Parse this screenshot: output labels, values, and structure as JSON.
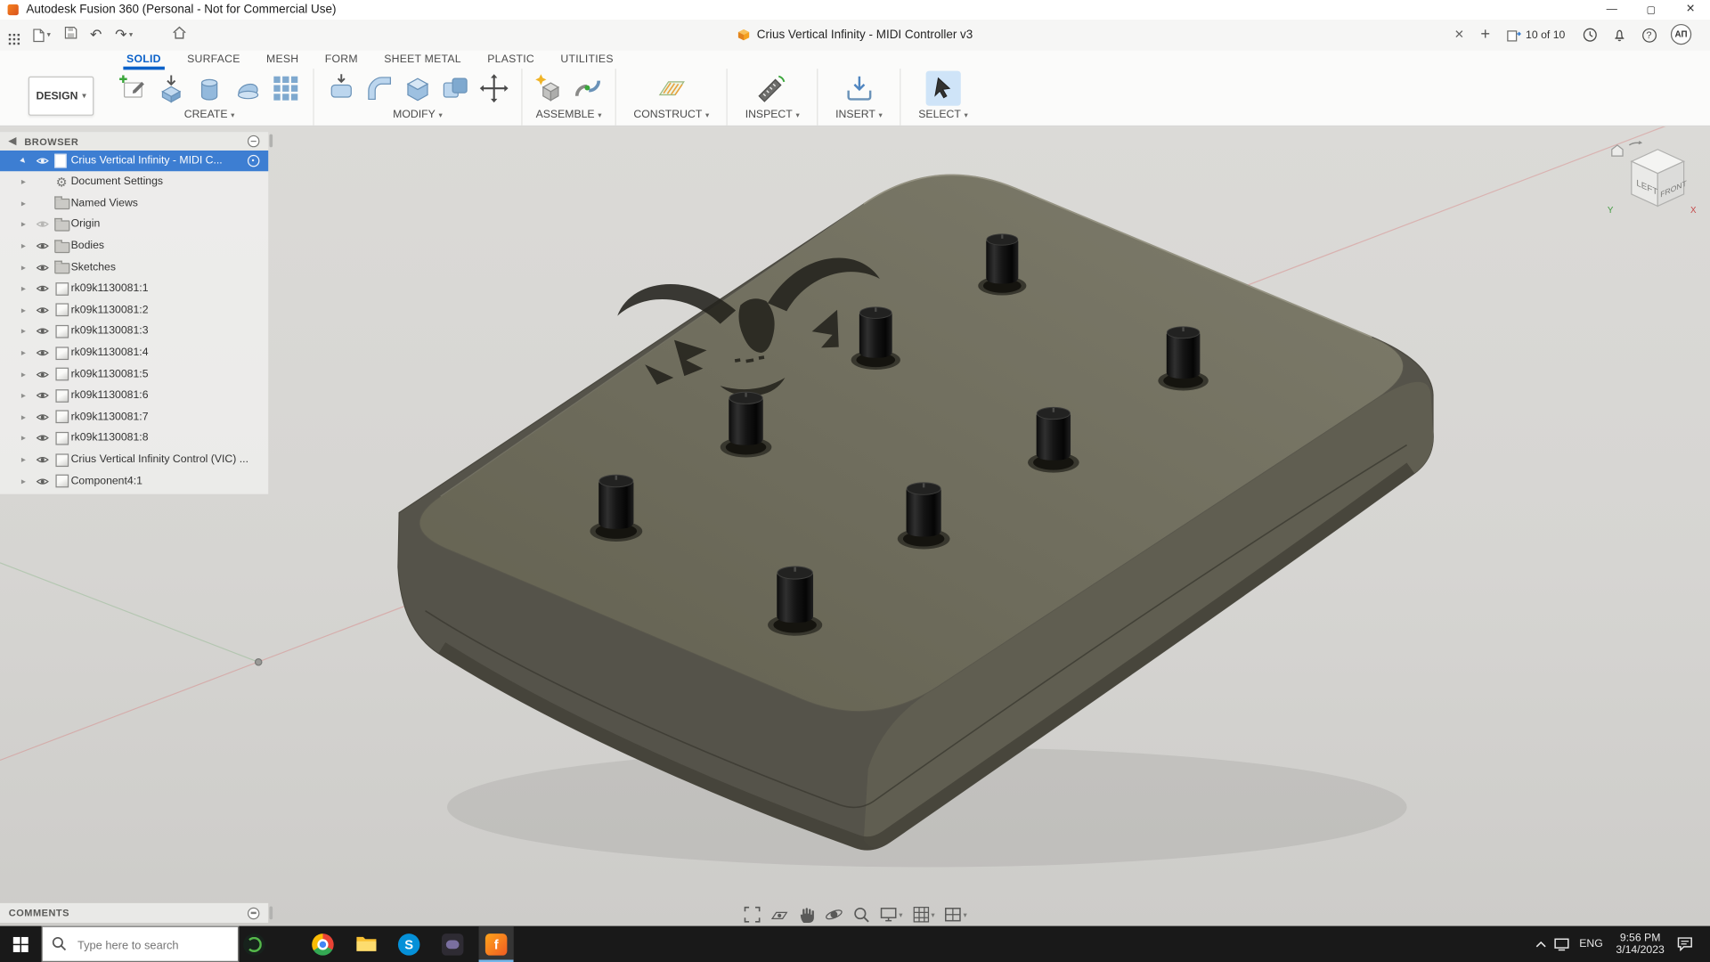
{
  "window": {
    "title": "Autodesk Fusion 360 (Personal - Not for Commercial Use)"
  },
  "tabbar": {
    "document_title": "Crius Vertical Infinity - MIDI Controller v3",
    "job_status": "10 of 10",
    "avatar": "АП",
    "icons": [
      "app-grid-icon",
      "file-menu-icon",
      "save-icon",
      "undo-icon",
      "redo-icon",
      "home-icon",
      "close-tab-icon",
      "new-tab-icon",
      "job-status-icon",
      "clock-icon",
      "notifications-bell-icon",
      "help-icon"
    ]
  },
  "ribbon": {
    "workspace_label": "DESIGN",
    "active_tab": "SOLID",
    "tabs": [
      {
        "label": "SOLID",
        "active": true
      },
      {
        "label": "SURFACE"
      },
      {
        "label": "MESH"
      },
      {
        "label": "FORM"
      },
      {
        "label": "SHEET METAL"
      },
      {
        "label": "PLASTIC"
      },
      {
        "label": "UTILITIES"
      }
    ],
    "groups": [
      {
        "label": "CREATE",
        "icons": [
          "create-sketch-icon",
          "extrude-icon",
          "revolve-icon",
          "loft-icon",
          "pattern-icon"
        ]
      },
      {
        "label": "MODIFY",
        "icons": [
          "press-pull-icon",
          "fillet-icon",
          "shell-icon",
          "combine-icon",
          "move-icon"
        ]
      },
      {
        "label": "ASSEMBLE",
        "icons": [
          "new-component-icon",
          "joint-icon"
        ]
      },
      {
        "label": "CONSTRUCT",
        "icons": [
          "construction-plane-icon"
        ]
      },
      {
        "label": "INSPECT",
        "icons": [
          "measure-icon"
        ]
      },
      {
        "label": "INSERT",
        "icons": [
          "insert-icon"
        ]
      },
      {
        "label": "SELECT",
        "icons": [
          "select-cursor-icon"
        ]
      }
    ]
  },
  "browser": {
    "title": "BROWSER",
    "root_label": "Crius Vertical Infinity - MIDI C...",
    "items": [
      {
        "label": "Document Settings",
        "icon": "gear",
        "eye": "none"
      },
      {
        "label": "Named Views",
        "icon": "folder",
        "eye": "none"
      },
      {
        "label": "Origin",
        "icon": "folder",
        "eye": "off"
      },
      {
        "label": "Bodies",
        "icon": "folder",
        "eye": "on"
      },
      {
        "label": "Sketches",
        "icon": "folder",
        "eye": "on"
      },
      {
        "label": "rk09k1130081:1",
        "icon": "component",
        "eye": "on"
      },
      {
        "label": "rk09k1130081:2",
        "icon": "component",
        "eye": "on"
      },
      {
        "label": "rk09k1130081:3",
        "icon": "component",
        "eye": "on"
      },
      {
        "label": "rk09k1130081:4",
        "icon": "component",
        "eye": "on"
      },
      {
        "label": "rk09k1130081:5",
        "icon": "component",
        "eye": "on"
      },
      {
        "label": "rk09k1130081:6",
        "icon": "component",
        "eye": "on"
      },
      {
        "label": "rk09k1130081:7",
        "icon": "component",
        "eye": "on"
      },
      {
        "label": "rk09k1130081:8",
        "icon": "component",
        "eye": "on"
      },
      {
        "label": "Crius Vertical Infinity Control (VIC) ...",
        "icon": "component",
        "eye": "on"
      },
      {
        "label": "Component4:1",
        "icon": "component",
        "eye": "on"
      }
    ]
  },
  "comments": {
    "title": "COMMENTS"
  },
  "viewcube": {
    "faces": {
      "left": "LEFT",
      "front": "FRONT"
    },
    "axes": {
      "x": "X",
      "y": "Y"
    }
  },
  "navbar": {
    "icons": [
      "fit-icon",
      "look-at-icon",
      "pan-icon",
      "orbit-icon",
      "zoom-icon",
      "display-settings-icon",
      "grid-settings-icon",
      "viewports-icon"
    ]
  },
  "taskbar": {
    "search_placeholder": "Type here to search",
    "apps": [
      "green-app-icon",
      "chrome-icon",
      "file-explorer-icon",
      "skype-icon",
      "dark-app-icon",
      "fusion-360-icon"
    ],
    "tray": {
      "language": "ENG",
      "time": "9:56 PM",
      "date": "3/14/2023"
    }
  },
  "colors": {
    "selection_blue": "#3d7ed2",
    "active_tab_blue": "#0b61c9",
    "model_olive": "#6f6d5d",
    "fusion_orange": "#f26722",
    "taskbar_dark": "#191919"
  }
}
